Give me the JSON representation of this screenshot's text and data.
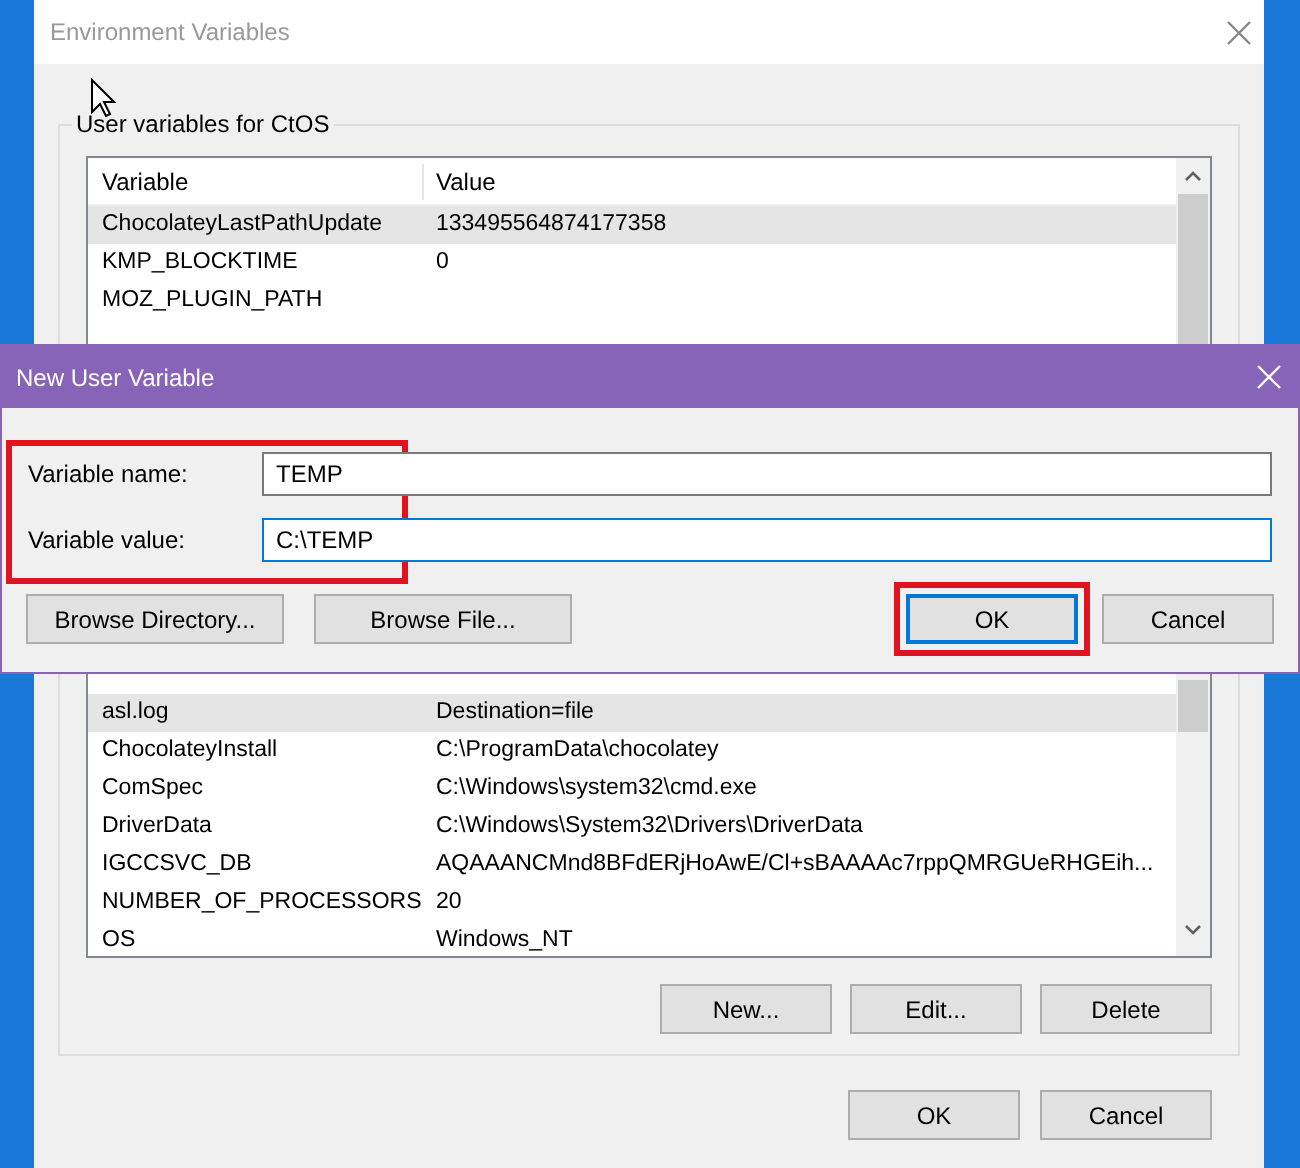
{
  "window": {
    "title": "Environment Variables"
  },
  "user_variables": {
    "title": "User variables for CtOS",
    "columns": [
      "Variable",
      "Value"
    ],
    "rows": [
      {
        "variable": "ChocolateyLastPathUpdate",
        "value": "133495564874177358",
        "selected": true
      },
      {
        "variable": "KMP_BLOCKTIME",
        "value": "0",
        "selected": false
      },
      {
        "variable": "MOZ_PLUGIN_PATH",
        "selected": false
      }
    ]
  },
  "dialog": {
    "title": "New User Variable",
    "fields_highlighted": true,
    "fields": [
      {
        "label": "Variable name:",
        "value": "TEMP",
        "focused": false
      },
      {
        "label": "Variable value:",
        "value": "C:\\TEMP",
        "focused": true
      }
    ],
    "buttons": [
      {
        "label": "Browse Directory...",
        "default": false,
        "highlighted": false
      },
      {
        "label": "Browse File...",
        "default": false,
        "highlighted": false
      },
      {
        "label": "OK",
        "default": true,
        "highlighted": true
      },
      {
        "label": "Cancel",
        "default": false,
        "highlighted": false
      }
    ]
  },
  "system_variables": {
    "rows": [
      {
        "variable": "asl.log",
        "value": "Destination=file",
        "selected": true
      },
      {
        "variable": "ChocolateyInstall",
        "value": "C:\\ProgramData\\chocolatey",
        "selected": false
      },
      {
        "variable": "ComSpec",
        "value": "C:\\Windows\\system32\\cmd.exe",
        "selected": false
      },
      {
        "variable": "DriverData",
        "value": "C:\\Windows\\System32\\Drivers\\DriverData",
        "selected": false
      },
      {
        "variable": "IGCCSVC_DB",
        "value": "AQAAANCMnd8BFdERjHoAwE/Cl+sBAAAAc7rppQMRGUeRHGEih...",
        "selected": false
      },
      {
        "variable": "NUMBER_OF_PROCESSORS",
        "value": "20",
        "selected": false
      },
      {
        "variable": "OS",
        "value": "Windows_NT",
        "selected": false
      }
    ],
    "buttons": [
      "New...",
      "Edit...",
      "Delete"
    ]
  },
  "buttons": [
    "OK",
    "Cancel"
  ]
}
